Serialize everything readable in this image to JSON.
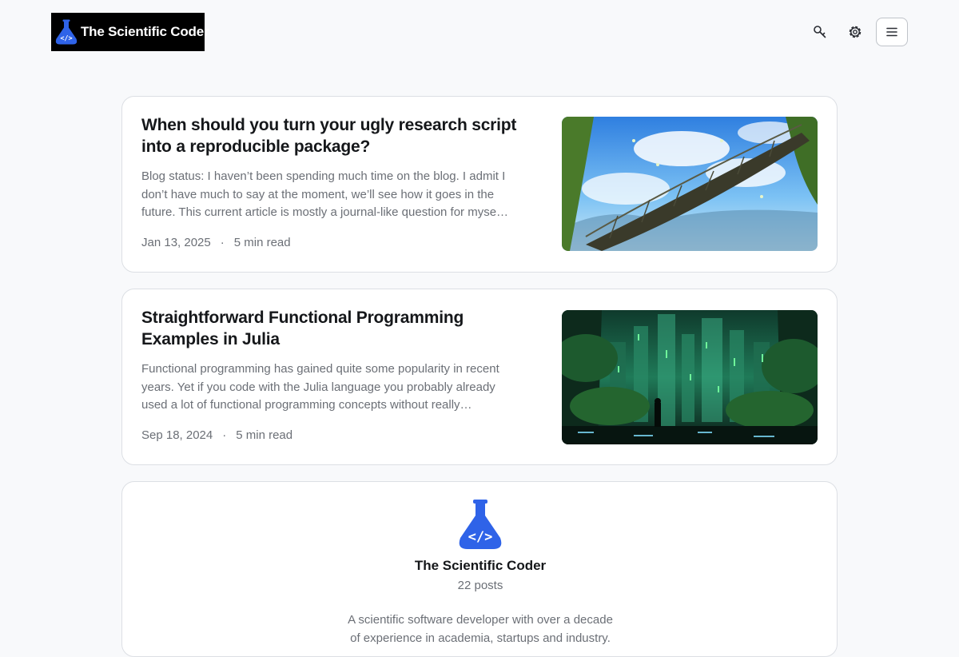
{
  "header": {
    "logo_text": "The Scientific Coder",
    "search_icon": "search-key-icon",
    "settings_icon": "gear-icon",
    "menu_icon": "hamburger-menu-icon"
  },
  "posts": [
    {
      "title": "When should you turn your ugly research script into a reproducible package?",
      "excerpt": "Blog status: I haven’t been spending much time on the blog. I admit I don’t have much to say at the moment, we’ll see how it goes in the future. This current article is mostly a journal-like question for myse…",
      "date": "Jan 13, 2025",
      "separator": "·",
      "read_time": "5 min read"
    },
    {
      "title": "Straightforward Functional Programming Examples in Julia",
      "excerpt": "Functional programming has gained quite some popularity in recent years. Yet if you code with the Julia language you probably already used a lot of functional programming concepts without really…",
      "date": "Sep 18, 2024",
      "separator": "·",
      "read_time": "5 min read"
    }
  ],
  "author": {
    "name": "The Scientific Coder",
    "post_count": "22 posts",
    "bio": "A scientific software developer with over a decade of experience in academia, startups and industry."
  },
  "colors": {
    "brand_blue": "#2f63e8",
    "background": "#f8f9fb",
    "card_border": "#dcdfe4"
  }
}
